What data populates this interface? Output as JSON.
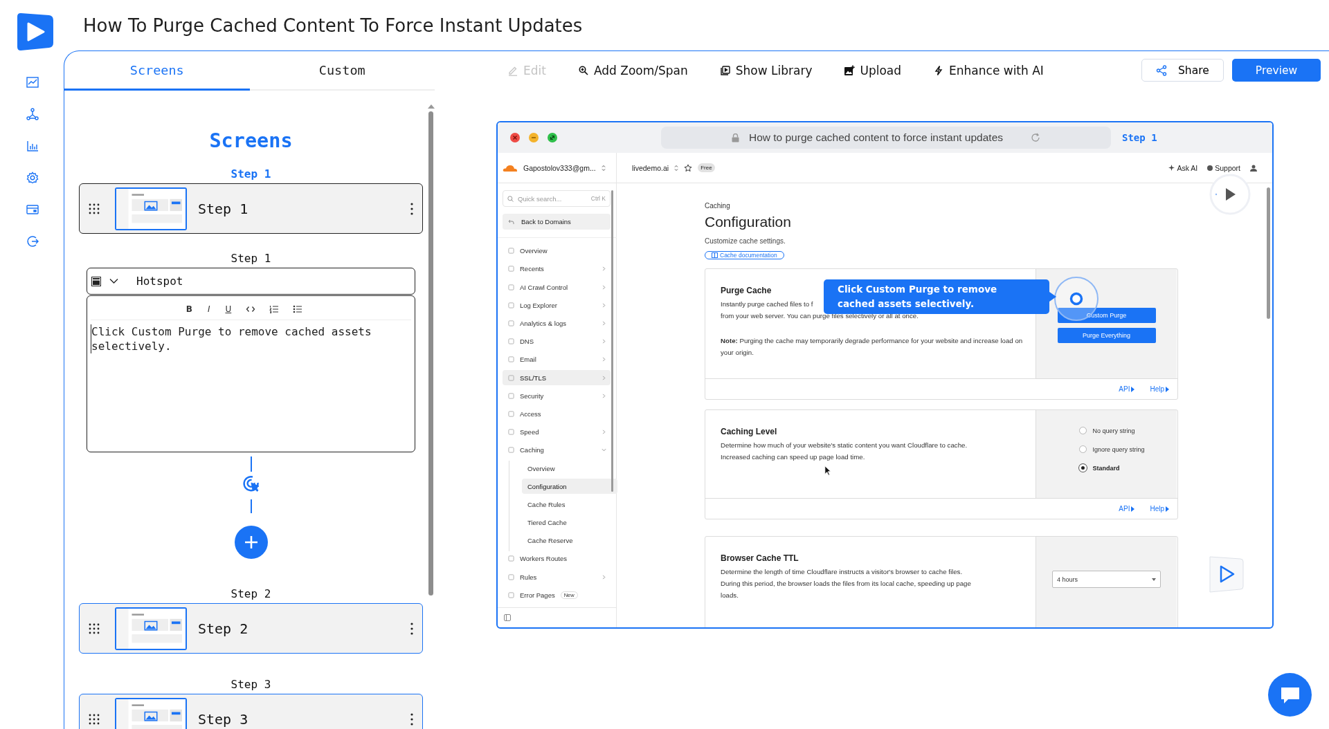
{
  "app": {
    "title": "How To Purge Cached Content To Force Instant Updates"
  },
  "tabs": [
    {
      "label": "Screens",
      "selected": true
    },
    {
      "label": "Custom",
      "selected": false
    }
  ],
  "toolbar": [
    {
      "kind": "edit",
      "label": "Edit",
      "disabled": true
    },
    {
      "kind": "zoom",
      "label": "Add Zoom/Span",
      "disabled": false
    },
    {
      "kind": "library",
      "label": "Show Library",
      "disabled": false
    },
    {
      "kind": "upload",
      "label": "Upload",
      "disabled": false
    },
    {
      "kind": "ai",
      "label": "Enhance with AI",
      "disabled": false
    }
  ],
  "actions": [
    {
      "kind": "share",
      "label": "Share"
    },
    {
      "kind": "preview",
      "label": "Preview"
    }
  ],
  "screens": {
    "heading": "Screens",
    "steps": [
      {
        "label": "Step 1",
        "title": "Step 1",
        "selected": true,
        "editor": {
          "label": "Step 1",
          "type": "Hotspot",
          "format_buttons": [
            "B",
            "I",
            "U"
          ],
          "text": "Click Custom Purge to remove cached assets selectively."
        }
      },
      {
        "label": "Step 2",
        "title": "Step 2",
        "selected": false
      },
      {
        "label": "Step 3",
        "title": "Step 3",
        "selected": false
      }
    ]
  },
  "preview": {
    "browser": {
      "url_title": "How to purge cached content to force instant updates",
      "step": "Step 1"
    },
    "header": {
      "account": "Gapostolov333@gm...",
      "domain": "livedemo.ai",
      "plan": "Free",
      "links": [
        "Ask AI",
        "Support"
      ]
    },
    "sidebar": {
      "search": {
        "placeholder": "Quick search...",
        "shortcut": "Ctrl K"
      },
      "back": "Back to Domains",
      "items": [
        {
          "label": "Overview",
          "selected": false
        },
        {
          "label": "Recents",
          "selected": false,
          "expanded": false
        },
        {
          "label": "AI Crawl Control",
          "selected": false,
          "expanded": false
        },
        {
          "label": "Log Explorer",
          "selected": false,
          "expanded": false
        },
        {
          "label": "Analytics & logs",
          "selected": false,
          "expanded": false
        },
        {
          "label": "DNS",
          "selected": false,
          "expanded": false
        },
        {
          "label": "Email",
          "selected": false,
          "expanded": false
        },
        {
          "label": "SSL/TLS",
          "selected": true,
          "expanded": false
        },
        {
          "label": "Security",
          "selected": false,
          "expanded": false
        },
        {
          "label": "Access",
          "selected": false
        },
        {
          "label": "Speed",
          "selected": false,
          "expanded": false
        },
        {
          "label": "Caching",
          "selected": false,
          "expanded": true,
          "children": [
            {
              "label": "Overview",
              "selected": false
            },
            {
              "label": "Configuration",
              "selected": true
            },
            {
              "label": "Cache Rules",
              "selected": false
            },
            {
              "label": "Tiered Cache",
              "selected": false
            },
            {
              "label": "Cache Reserve",
              "selected": false
            }
          ]
        },
        {
          "label": "Workers Routes",
          "selected": false
        },
        {
          "label": "Rules",
          "selected": false,
          "expanded": false
        },
        {
          "label": "Error Pages",
          "selected": false,
          "badge": "New"
        }
      ]
    },
    "content": {
      "breadcrumb": "Caching",
      "title": "Configuration",
      "subtitle": "Customize cache settings.",
      "doc_link": "Cache documentation",
      "cards": [
        {
          "kind": "buttons",
          "title": "Purge Cache",
          "lines": [
            "Instantly purge cached files to f",
            "from your web server. You can purge files selectively or all at once."
          ],
          "note": "**Note:** Purging the cache may temporarily degrade performance for your website and increase load on your origin.",
          "buttons": [
            "Custom Purge",
            "Purge Everything"
          ],
          "links": [
            "API",
            "Help"
          ]
        },
        {
          "kind": "radios",
          "title": "Caching Level",
          "lines": [
            "Determine how much of your website's static content you want Cloudflare to cache.",
            "Increased caching can speed up page load time."
          ],
          "options": [
            {
              "label": "No query string",
              "selected": false
            },
            {
              "label": "Ignore query string",
              "selected": false
            },
            {
              "label": "Standard",
              "selected": true
            }
          ],
          "links": [
            "API",
            "Help"
          ]
        },
        {
          "kind": "select",
          "title": "Browser Cache TTL",
          "lines": [
            "Determine the length of time Cloudflare instructs a visitor's browser to cache files.",
            "During this period, the browser loads the files from its local cache, speeding up page",
            "loads."
          ],
          "value": "4 hours"
        }
      ]
    },
    "tooltip": "Click Custom Purge to remove cached assets selectively."
  }
}
